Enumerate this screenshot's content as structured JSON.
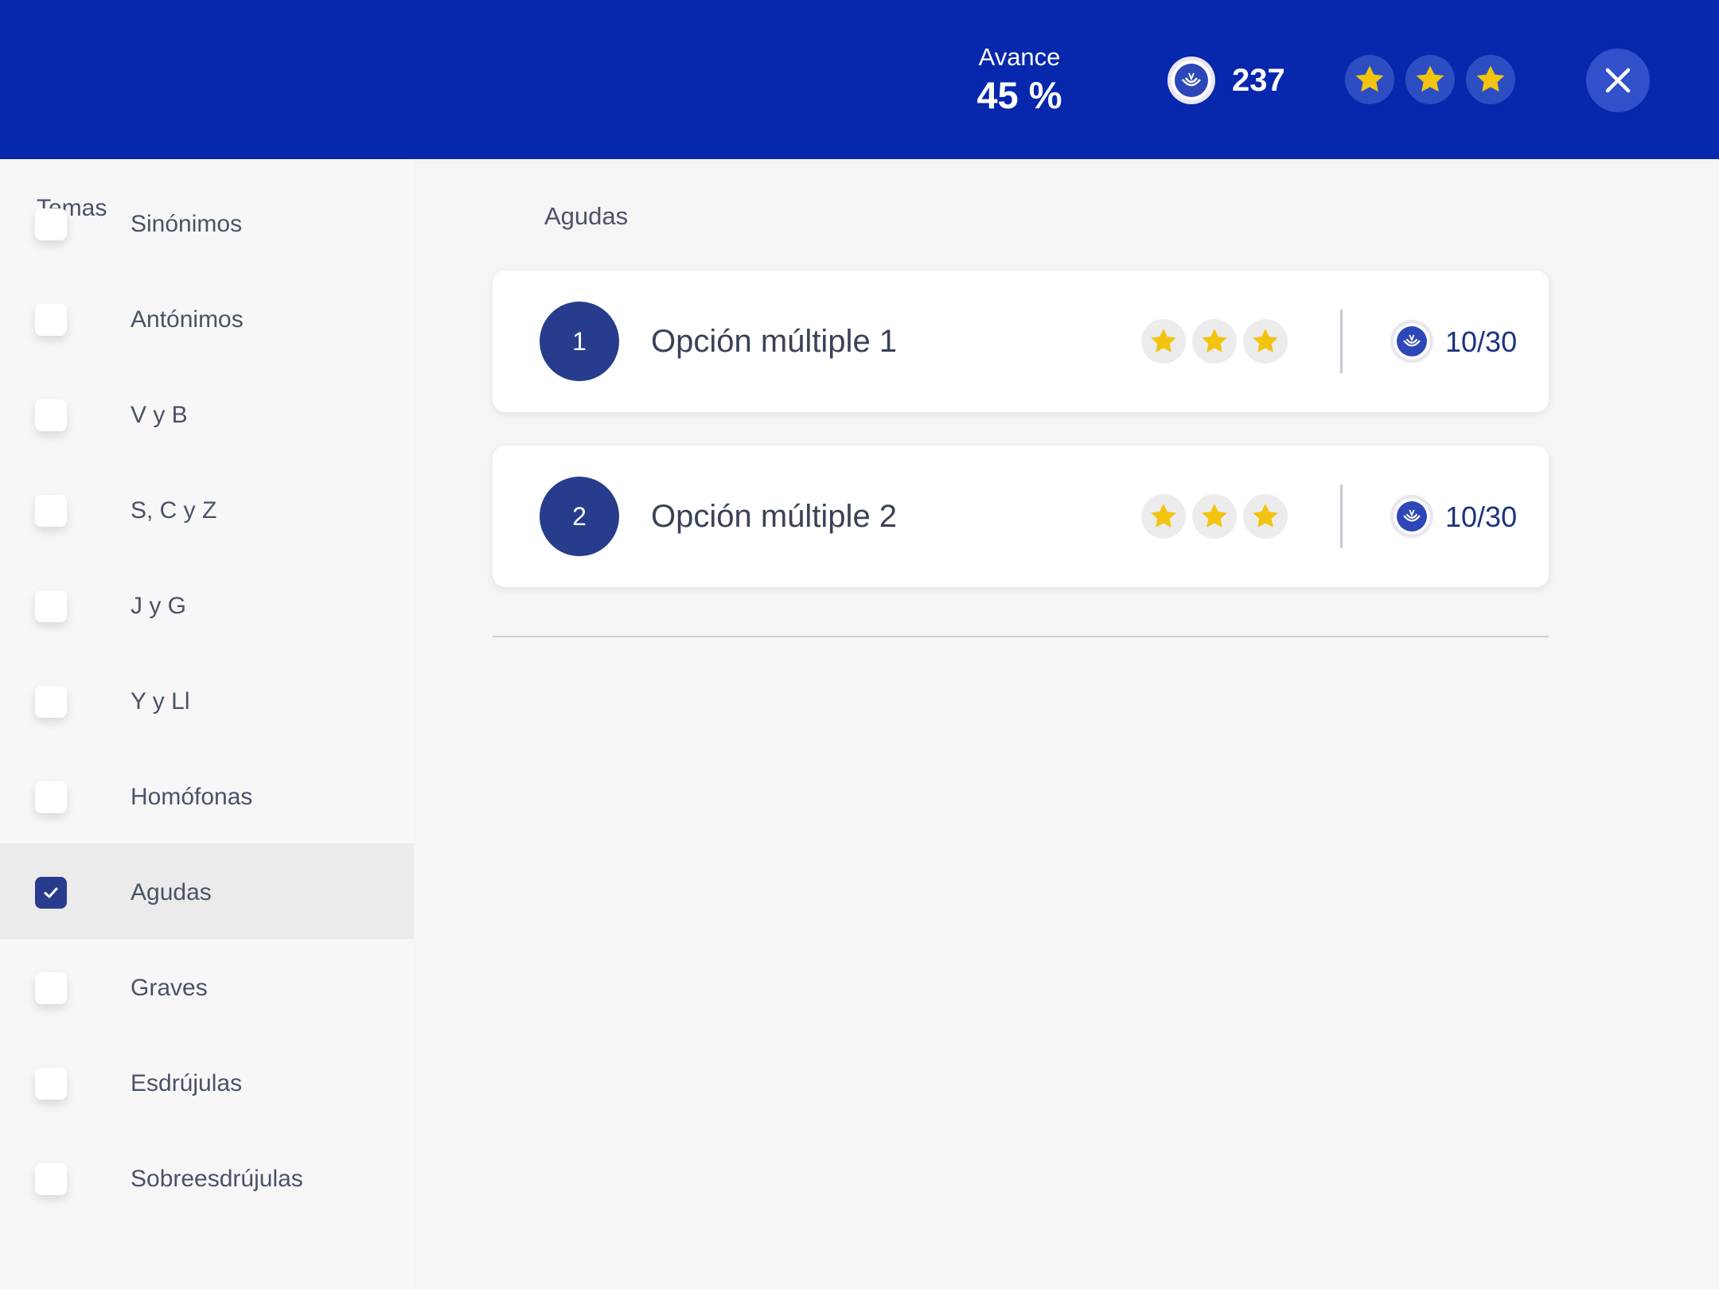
{
  "header": {
    "progress_label": "Avance",
    "progress_value": "45 %",
    "coins": "237",
    "stars": [
      "star-icon",
      "star-icon",
      "star-icon"
    ],
    "close_icon": "close-icon"
  },
  "sidebar": {
    "title": "Temas",
    "items": [
      {
        "label": "Sinónimos",
        "checked": false
      },
      {
        "label": "Antónimos",
        "checked": false
      },
      {
        "label": "V y B",
        "checked": false
      },
      {
        "label": "S, C y Z",
        "checked": false
      },
      {
        "label": "J y G",
        "checked": false
      },
      {
        "label": "Y y Ll",
        "checked": false
      },
      {
        "label": "Homófonas",
        "checked": false
      },
      {
        "label": "Agudas",
        "checked": true
      },
      {
        "label": "Graves",
        "checked": false
      },
      {
        "label": "Esdrújulas",
        "checked": false
      },
      {
        "label": "Sobreesdrújulas",
        "checked": false
      }
    ]
  },
  "main": {
    "title": "Agudas",
    "activities": [
      {
        "number": "1",
        "title": "Opción múltiple 1",
        "stars": 3,
        "score": "10/30"
      },
      {
        "number": "2",
        "title": "Opción múltiple 2",
        "stars": 3,
        "score": "10/30"
      }
    ]
  },
  "colors": {
    "header_bg": "#0727ad",
    "accent": "#283c8d",
    "star": "#f2c40f"
  }
}
